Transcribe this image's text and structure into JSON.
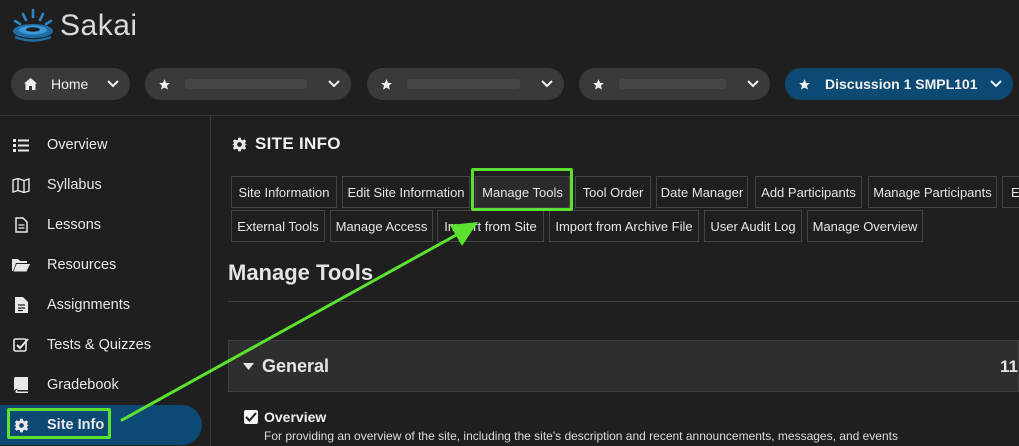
{
  "logo": {
    "text": "Sakai"
  },
  "topnav": {
    "home": "Home",
    "active_site": "Discussion 1 SMPL101"
  },
  "sidebar": {
    "items": [
      {
        "label": "Overview",
        "icon": "list-icon"
      },
      {
        "label": "Syllabus",
        "icon": "map-icon"
      },
      {
        "label": "Lessons",
        "icon": "document-icon"
      },
      {
        "label": "Resources",
        "icon": "folder-open-icon"
      },
      {
        "label": "Assignments",
        "icon": "file-text-icon"
      },
      {
        "label": "Tests & Quizzes",
        "icon": "check-square-icon"
      },
      {
        "label": "Gradebook",
        "icon": "book-icon"
      },
      {
        "label": "Site Info",
        "icon": "gear-icon"
      }
    ]
  },
  "main": {
    "section_title": "SITE INFO",
    "tabs_row1": [
      "Site Information",
      "Edit Site Information",
      "Manage Tools",
      "Tool Order",
      "Date Manager",
      "Add Participants",
      "Manage Participants",
      "Ed"
    ],
    "tabs_row2": [
      "External Tools",
      "Manage Access",
      "Import from Site",
      "Import from Archive File",
      "User Audit Log",
      "Manage Overview"
    ],
    "page_title": "Manage Tools",
    "general": {
      "label": "General",
      "count": "11"
    },
    "tools": [
      {
        "name": "Overview",
        "checked": true,
        "description": "For providing an overview of the site, including the site's description and recent announcements, messages, and events"
      }
    ]
  },
  "colors": {
    "background": "#1f1f1f",
    "active_nav": "#0d4a73",
    "annotation_green": "#5be22e"
  }
}
